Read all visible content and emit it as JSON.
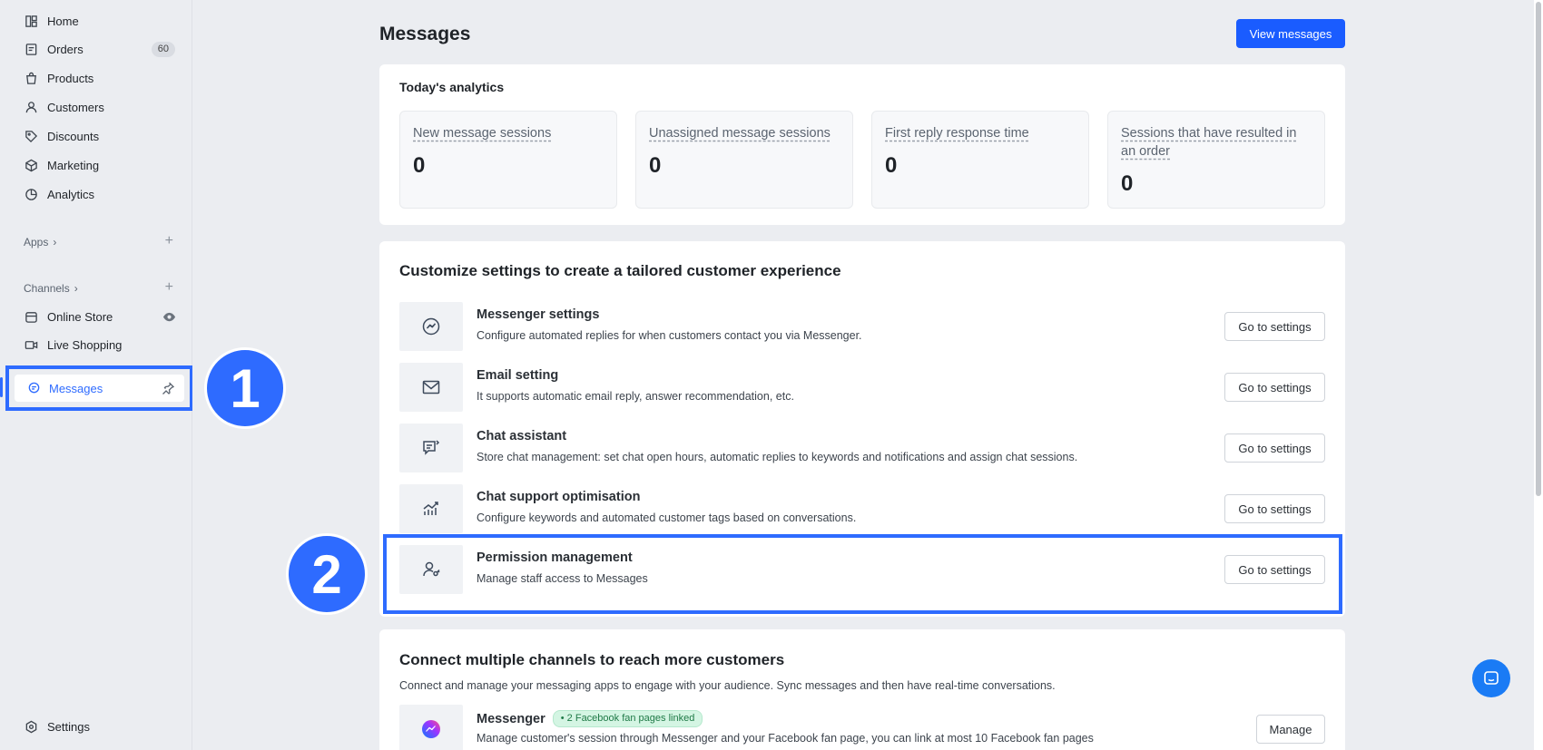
{
  "sidebar": {
    "items": [
      {
        "label": "Home",
        "icon": "home-icon"
      },
      {
        "label": "Orders",
        "icon": "orders-icon",
        "badge": "60"
      },
      {
        "label": "Products",
        "icon": "products-icon"
      },
      {
        "label": "Customers",
        "icon": "customers-icon"
      },
      {
        "label": "Discounts",
        "icon": "discounts-icon"
      },
      {
        "label": "Marketing",
        "icon": "marketing-icon"
      },
      {
        "label": "Analytics",
        "icon": "analytics-icon"
      }
    ],
    "apps_label": "Apps",
    "channels_label": "Channels",
    "channels": [
      {
        "label": "Online Store",
        "icon": "store-icon"
      },
      {
        "label": "Live Shopping",
        "icon": "video-icon"
      }
    ],
    "active_item": "Messages",
    "settings_label": "Settings"
  },
  "annotations": {
    "step1": "1",
    "step2": "2"
  },
  "header": {
    "title": "Messages",
    "view_messages_label": "View messages"
  },
  "analytics": {
    "title": "Today's analytics",
    "stats": [
      {
        "label": "New message sessions",
        "value": "0"
      },
      {
        "label": "Unassigned message sessions",
        "value": "0"
      },
      {
        "label": "First reply response time",
        "value": "0"
      },
      {
        "label": "Sessions that have resulted in an order",
        "value": "0"
      }
    ]
  },
  "settings_section": {
    "title": "Customize settings to create a tailored customer experience",
    "button_label": "Go to settings",
    "rows": [
      {
        "title": "Messenger settings",
        "desc": "Configure automated replies for when customers contact you via Messenger.",
        "icon": "messenger-outline-icon"
      },
      {
        "title": "Email setting",
        "desc": "It supports automatic email reply, answer recommendation, etc.",
        "icon": "email-icon"
      },
      {
        "title": "Chat assistant",
        "desc": "Store chat management: set chat open hours, automatic replies to keywords and notifications and assign chat sessions.",
        "icon": "chat-assistant-icon"
      },
      {
        "title": "Chat support optimisation",
        "desc": "Configure keywords and automated customer tags based on conversations.",
        "icon": "chart-up-icon"
      },
      {
        "title": "Permission management",
        "desc": "Manage staff access to Messages",
        "icon": "user-key-icon"
      }
    ]
  },
  "channels_section": {
    "title": "Connect multiple channels to reach more customers",
    "desc": "Connect and manage your messaging apps to engage with your audience. Sync messages and then have real-time conversations.",
    "messenger": {
      "title": "Messenger",
      "badge": "• 2 Facebook fan pages linked",
      "desc": "Manage customer's session through Messenger and your Facebook fan page, you can link at most 10 Facebook fan pages",
      "button_label": "Manage"
    }
  },
  "colors": {
    "accent": "#1a5cff",
    "highlight": "#2e6bff",
    "background": "#ebedf1"
  }
}
